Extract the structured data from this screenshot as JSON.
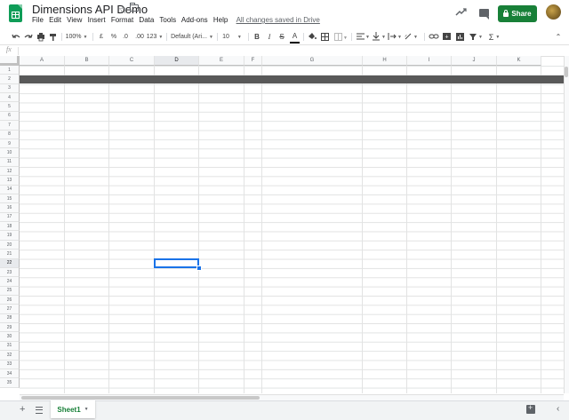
{
  "header": {
    "title": "Dimensions API Demo",
    "menu": [
      "File",
      "Edit",
      "View",
      "Insert",
      "Format",
      "Data",
      "Tools",
      "Add-ons",
      "Help"
    ],
    "saved_status": "All changes saved in Drive",
    "share_label": "Share"
  },
  "toolbar": {
    "zoom": "100%",
    "currency": "£",
    "percent": "%",
    "decimal_decrease": ".0",
    "decimal_increase": ".00",
    "more_formats": "123",
    "font": "Default (Ari...",
    "font_size": "10",
    "bold": "B",
    "italic": "I",
    "strike": "S",
    "text_color": "A",
    "functions": "Σ"
  },
  "formula_bar": {
    "fx": "fx",
    "value": ""
  },
  "grid": {
    "columns": [
      "A",
      "B",
      "C",
      "D",
      "E",
      "F",
      "G",
      "H",
      "I",
      "J",
      "K"
    ],
    "rows": [
      "1",
      "2",
      "3",
      "4",
      "5",
      "6",
      "7",
      "8",
      "9",
      "10",
      "11",
      "12",
      "13",
      "14",
      "15",
      "16",
      "17",
      "18",
      "19",
      "20",
      "21",
      "22",
      "23",
      "24",
      "25",
      "26",
      "27",
      "28",
      "29",
      "30",
      "31",
      "32",
      "33",
      "34",
      "35"
    ],
    "active_cell": "D22",
    "active_column": "D",
    "active_row": "22",
    "highlighted_row": "2",
    "highlighted_row_color": "#595959"
  },
  "sheets": {
    "tabs": [
      {
        "label": "Sheet1",
        "active": true
      }
    ]
  },
  "colors": {
    "accent": "#188038",
    "selection": "#1a73e8"
  }
}
